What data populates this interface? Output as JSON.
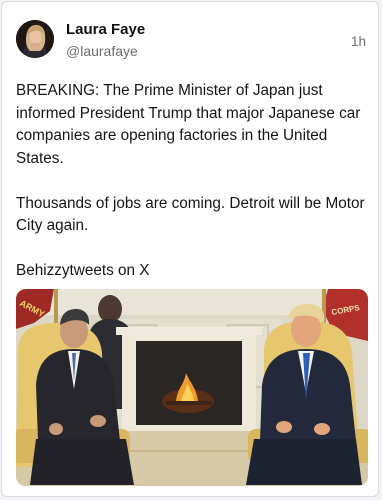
{
  "post": {
    "author": {
      "display_name": "Laura Faye",
      "handle": "@laurafaye",
      "avatar_icon": "profile-photo"
    },
    "timestamp": "1h",
    "text_paragraphs": [
      "BREAKING: The Prime Minister of Japan just informed President Trump that major Japanese car companies are opening factories in the United States.",
      "Thousands of jobs are coming. Detroit will be Motor City again.",
      "Behizzytweets on X"
    ],
    "media": {
      "banner_left": "ARMY",
      "banner_right": "CORPS"
    }
  }
}
